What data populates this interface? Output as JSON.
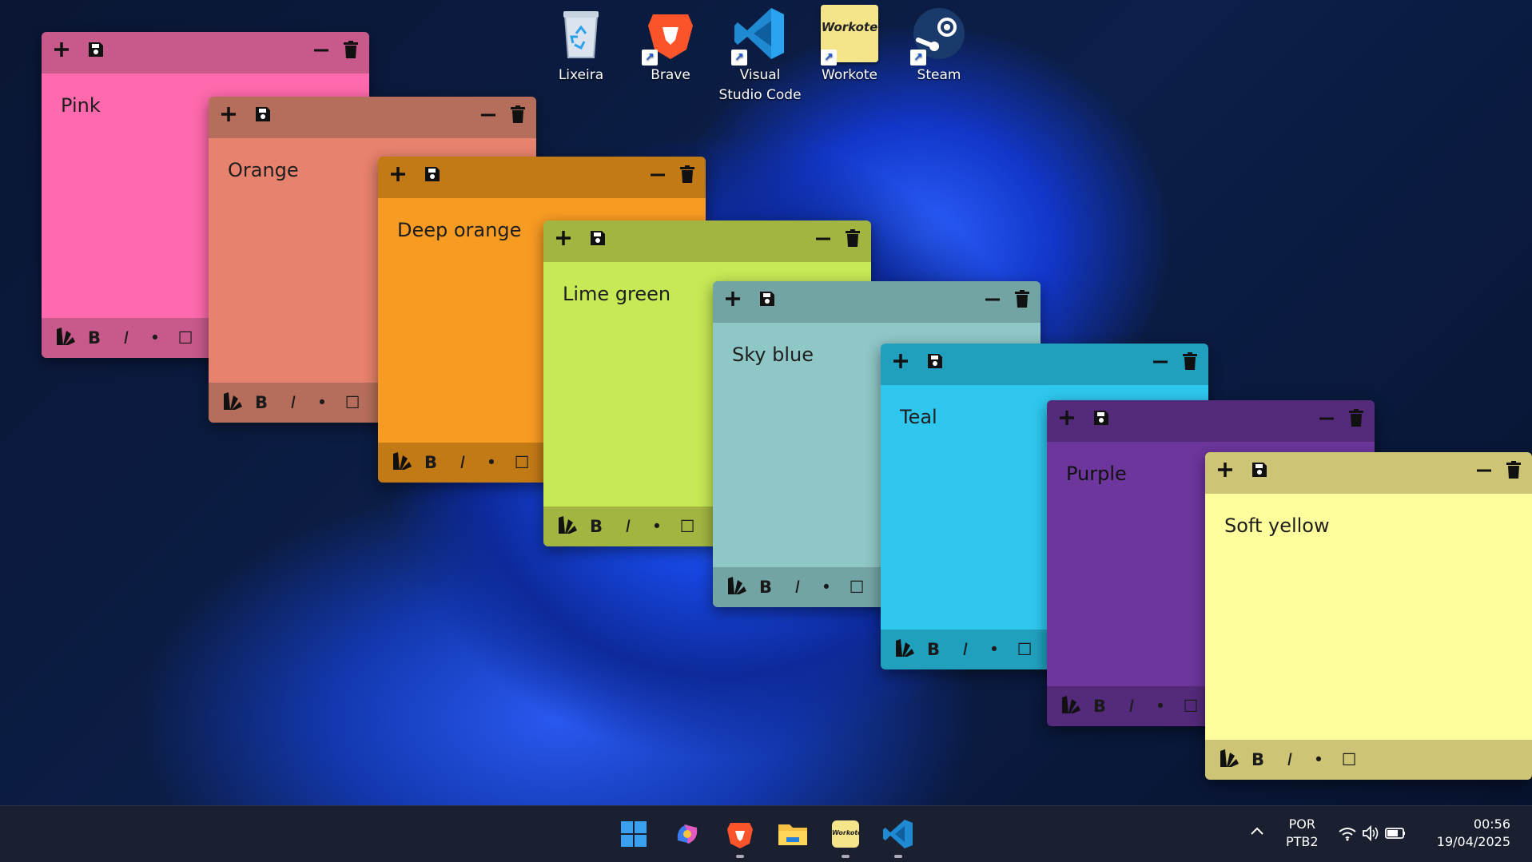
{
  "desktop": {
    "icons": [
      {
        "label": "Lixeira"
      },
      {
        "label": "Brave"
      },
      {
        "label": "Visual Studio Code"
      },
      {
        "label": "Workote"
      },
      {
        "label": "Steam"
      }
    ],
    "workote_logo_text": "Workote"
  },
  "notes": [
    {
      "title": "Pink",
      "header_color": "#c75a8a",
      "body_color": "#fe6aad",
      "footer_color": "#c75a8a"
    },
    {
      "title": "Orange",
      "header_color": "#b56e5b",
      "body_color": "#e6826d",
      "footer_color": "#b56e5b"
    },
    {
      "title": "Deep orange",
      "header_color": "#c27a16",
      "body_color": "#f79b22",
      "footer_color": "#c27a16"
    },
    {
      "title": "Lime green",
      "header_color": "#a3b541",
      "body_color": "#c7e956",
      "footer_color": "#a3b541"
    },
    {
      "title": "Sky blue",
      "header_color": "#73a4a4",
      "body_color": "#8fc6c6",
      "footer_color": "#73a4a4"
    },
    {
      "title": "Teal",
      "header_color": "#21a0be",
      "body_color": "#2fc7ee",
      "footer_color": "#21a0be"
    },
    {
      "title": "Purple",
      "header_color": "#542a7b",
      "body_color": "#6c369c",
      "footer_color": "#542a7b"
    },
    {
      "title": "Soft yellow",
      "header_color": "#cdc475",
      "body_color": "#fefe9c",
      "footer_color": "#cdc475"
    }
  ],
  "note_controls": {
    "add": "+",
    "bold": "B",
    "italic": "I",
    "bullet": "•",
    "checkbox": "☐"
  },
  "taskbar": {
    "apps": [
      "start",
      "copilot",
      "brave",
      "file-explorer",
      "workote",
      "vscode"
    ],
    "tray": {
      "language_top": "POR",
      "language_bottom": "PTB2",
      "time": "00:56",
      "date": "19/04/2025"
    }
  }
}
